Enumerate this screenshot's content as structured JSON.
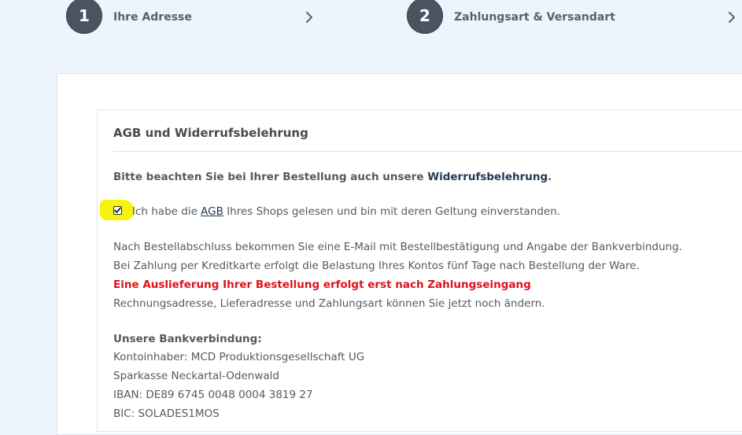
{
  "steps": [
    {
      "number": "1",
      "label": "Ihre Adresse"
    },
    {
      "number": "2",
      "label": "Zahlungsart & Versandart"
    }
  ],
  "panel": {
    "title": "AGB und Widerrufsbelehrung",
    "notice_prefix": "Bitte beachten Sie bei Ihrer Bestellung auch unsere ",
    "notice_link": "Widerrufsbelehrung",
    "notice_suffix": ".",
    "agb": {
      "checked": true,
      "prefix": "Ich habe die ",
      "link": "AGB",
      "suffix": " Ihres Shops gelesen und bin mit deren Geltung einverstanden."
    },
    "info_lines": [
      "Nach Bestellabschluss bekommen Sie eine E-Mail mit Bestellbestätigung und Angabe der Bankverbindung.",
      "Bei Zahlung per Kreditkarte erfolgt die Belastung Ihres Kontos fünf Tage nach Bestellung der Ware.",
      "Eine Auslieferung Ihrer Bestellung erfolgt erst nach Zahlungseingang",
      "Rechnungsadresse, Lieferadresse und Zahlungsart können Sie jetzt noch ändern."
    ],
    "bank": {
      "title": "Unsere Bankverbindung:",
      "lines": [
        "Kontoinhaber: MCD Produktionsgesellschaft UG",
        "Sparkasse Neckartal-Odenwald",
        "IBAN: DE89 6745 0048 0004 3819 27",
        "BIC: SOLADES1MOS"
      ]
    }
  },
  "colors": {
    "background": "#eef4fb",
    "step_circle": "#4a5461",
    "warning_text": "#e0121b",
    "link": "#243a55",
    "highlight": "#f6f200"
  },
  "icons": {
    "step_separator": "chevron-right-icon",
    "checkbox_mark": "check-icon"
  }
}
